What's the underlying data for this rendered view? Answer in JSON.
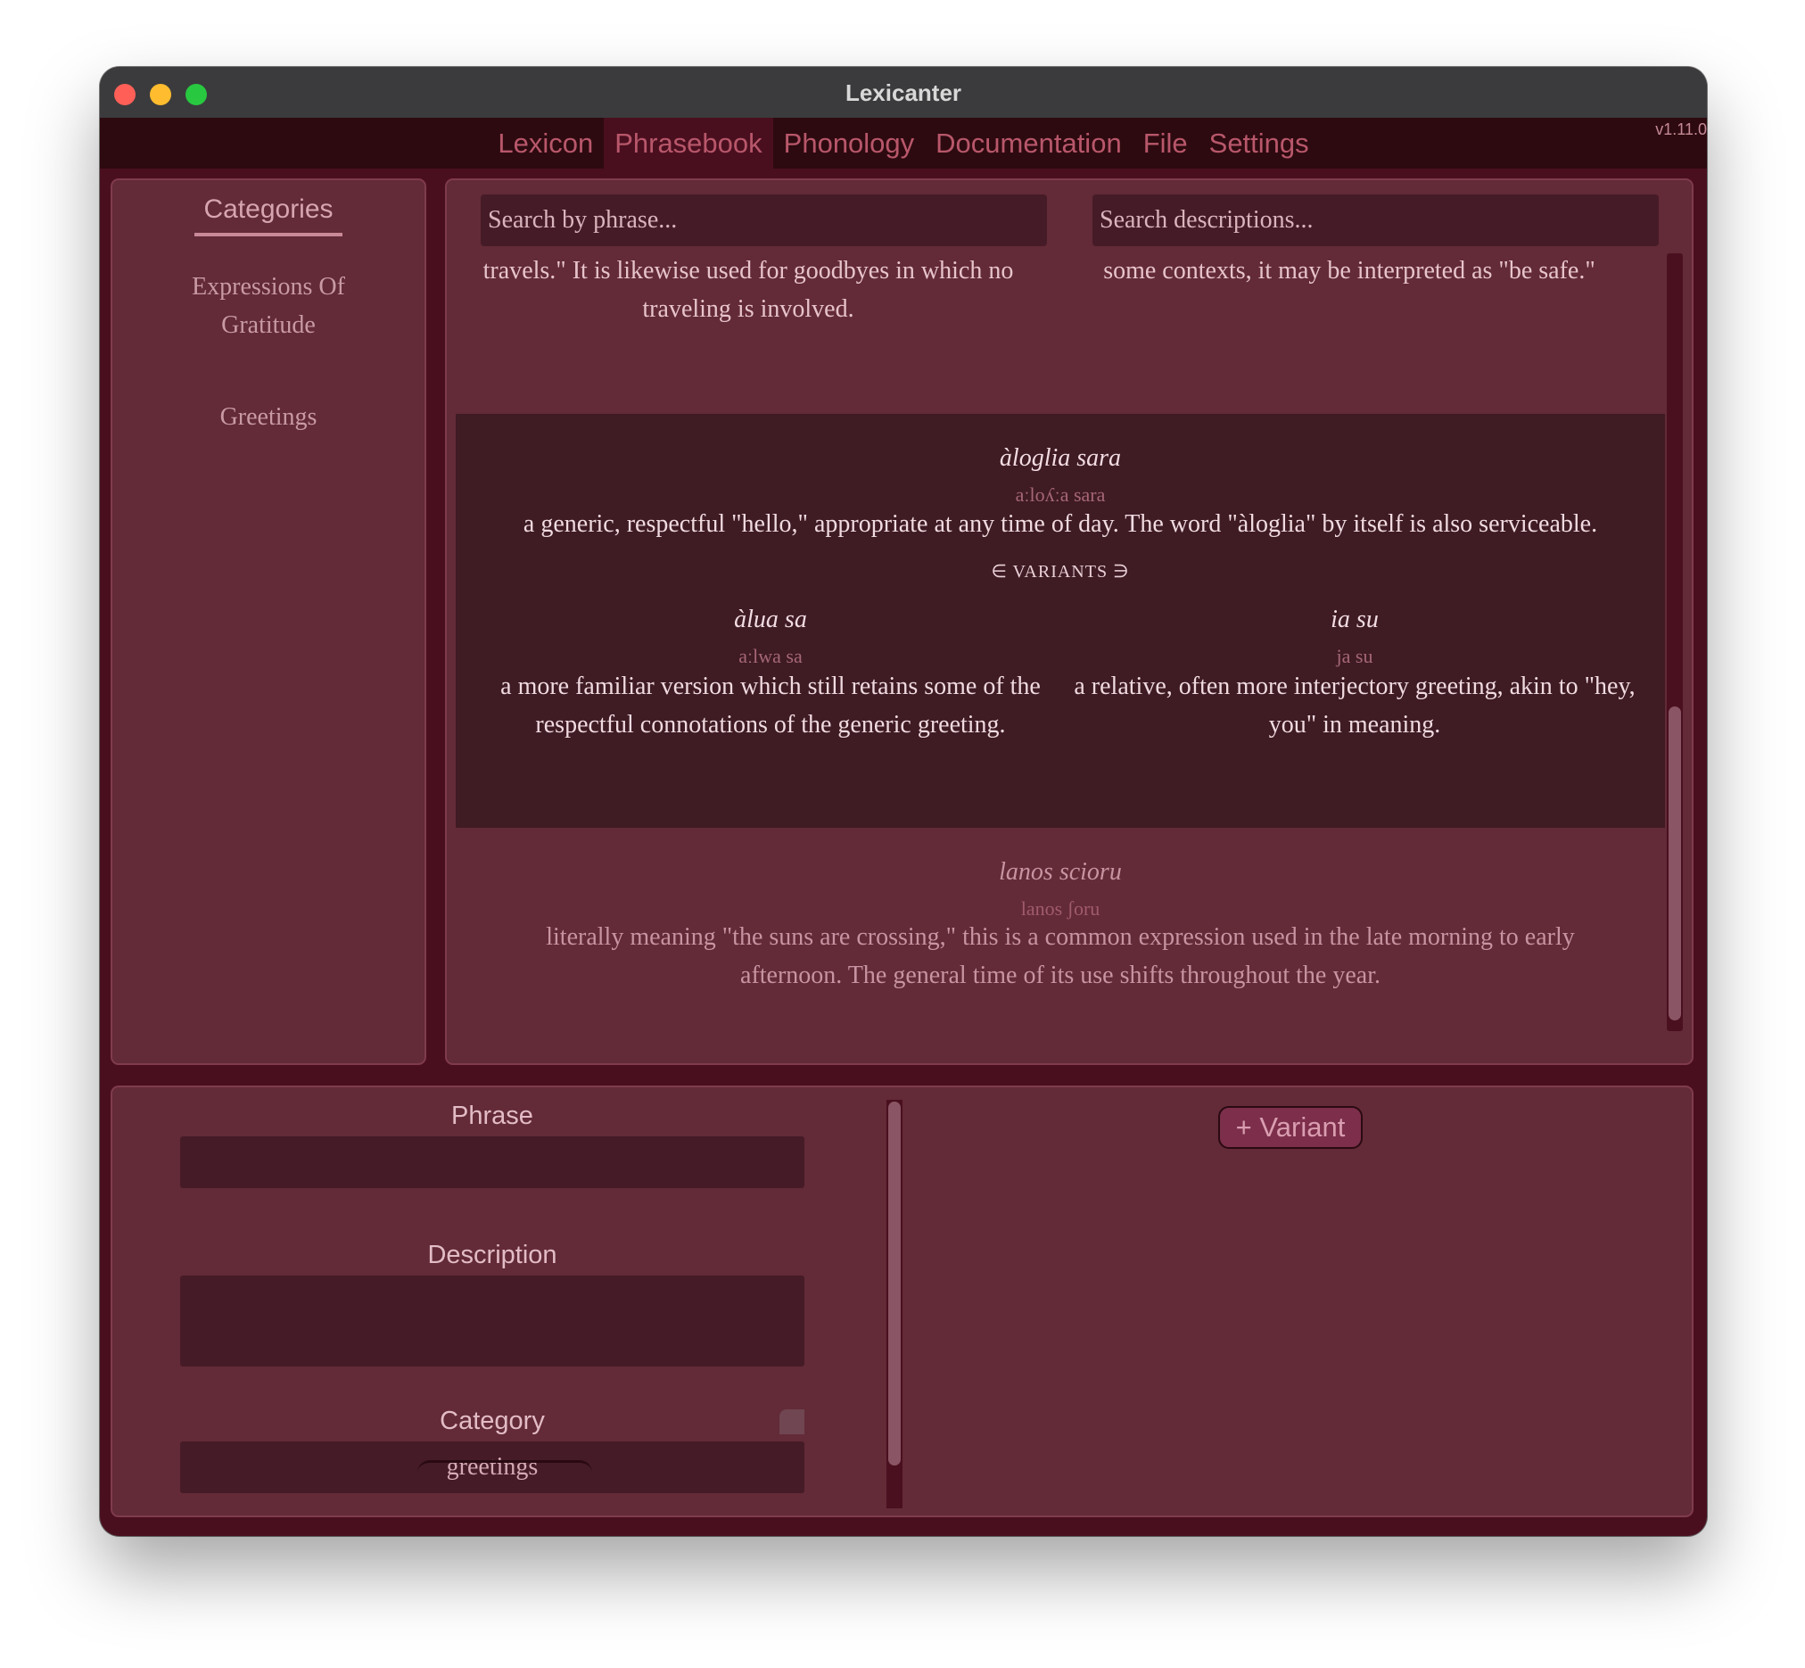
{
  "window": {
    "title": "Lexicanter",
    "version": "v1.11.0"
  },
  "menu": {
    "items": [
      "Lexicon",
      "Phrasebook",
      "Phonology",
      "Documentation",
      "File",
      "Settings"
    ],
    "active": "Phrasebook"
  },
  "categories": {
    "title": "Categories",
    "items": [
      "Expressions Of Gratitude",
      "Greetings"
    ]
  },
  "search": {
    "phrase_placeholder": "Search by phrase...",
    "description_placeholder": "Search descriptions..."
  },
  "entries": {
    "top_variant_left_desc": "translating loosely as \"may you have many safe travels.\" It is likewise used for goodbyes in which no traveling is involved.",
    "top_variant_right_desc": "a simple goodbye in the same spirit of \"safe travels.\" In some contexts, it may be interpreted as \"be safe.\"",
    "selected": {
      "phrase": "àloglia sara",
      "pronunciation": "aːloʎːa sara",
      "description": "a generic, respectful \"hello,\" appropriate at any time of day. The word \"àloglia\" by itself is also serviceable.",
      "variants_label": "∈ VARIANTS ∋",
      "variants": [
        {
          "phrase": "àlua sa",
          "pronunciation": "aːlwa sa",
          "description": "a more familiar version which still retains some of the respectful connotations of the generic greeting."
        },
        {
          "phrase": "ia su",
          "pronunciation": "ja su",
          "description": "a relative, often more interjectory greeting, akin to \"hey, you\" in meaning."
        }
      ]
    },
    "next": {
      "phrase": "lanos scioru",
      "pronunciation": "lanos ʃoru",
      "description": "literally meaning \"the suns are crossing,\" this is a common expression used in the late morning to early afternoon. The general time of its use shifts throughout the year."
    }
  },
  "editor": {
    "phrase_label": "Phrase",
    "phrase_value": "",
    "description_label": "Description",
    "description_value": "",
    "category_label": "Category",
    "category_value": "greetings",
    "add_variant_label": "+ Variant"
  }
}
